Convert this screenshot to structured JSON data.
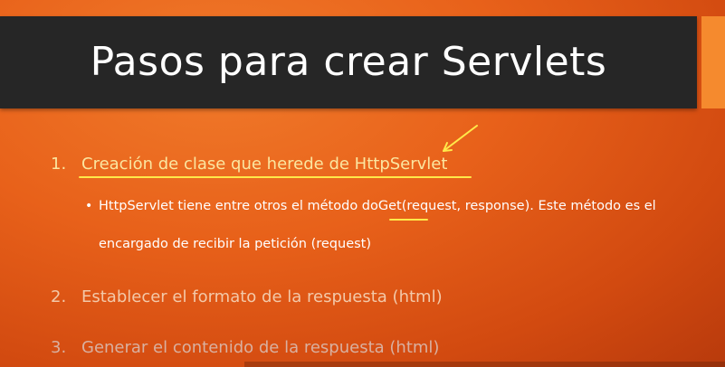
{
  "slide": {
    "title": "Pasos para crear Servlets",
    "items": [
      {
        "number": "1.",
        "text": "Creación de clase que herede de HttpServlet"
      },
      {
        "number": "2.",
        "text": "Establecer el formato de la respuesta (html)"
      },
      {
        "number": "3.",
        "text": "Generar el contenido de la respuesta (html)"
      }
    ],
    "subitem": {
      "bullet": "•",
      "line1_pre": "HttpServlet tiene entre otros el método ",
      "line1_mark": "doGet",
      "line1_post": "(request, response). Este método es el",
      "line2": "encargado de recibir la petición (request)"
    }
  },
  "colors": {
    "background": "#e8611a",
    "title_bar": "#262626",
    "accent_block": "#f58a2e",
    "annotation": "#ffe94a"
  }
}
